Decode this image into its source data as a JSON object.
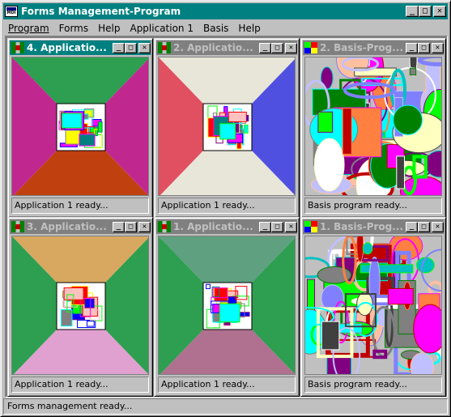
{
  "window": {
    "title": "Forms Management-Program",
    "buttons": {
      "minimize": "_",
      "maximize": "□",
      "close": "✕"
    }
  },
  "menu": [
    "Program",
    "Forms",
    "Help",
    "Application 1",
    "Basis",
    "Help"
  ],
  "children": [
    {
      "title": "4. Applicatio...",
      "status": "Application 1 ready...",
      "kind": "application",
      "active": true,
      "colors": {
        "top": "#2e9e50",
        "bottom": "#c04010",
        "left": "#c02890",
        "right": "#c02890"
      }
    },
    {
      "title": "2. Applicatio...",
      "status": "Application 1 ready...",
      "kind": "application",
      "active": false,
      "colors": {
        "top": "#e8e6d8",
        "bottom": "#e8e6d8",
        "left": "#e05060",
        "right": "#5050e0"
      }
    },
    {
      "title": "2. Basis-Prog...",
      "status": "Basis program ready...",
      "kind": "basis",
      "active": false
    },
    {
      "title": "3. Applicatio...",
      "status": "Application 1 ready...",
      "kind": "application",
      "active": false,
      "colors": {
        "top": "#d8a860",
        "bottom": "#e0a0d0",
        "left": "#2e9e50",
        "right": "#2e9e50"
      }
    },
    {
      "title": "1. Applicatio...",
      "status": "Application 1 ready...",
      "kind": "application",
      "active": false,
      "colors": {
        "top": "#5ea080",
        "bottom": "#b07090",
        "left": "#2e9e50",
        "right": "#2e9e50"
      }
    },
    {
      "title": "1. Basis-Prog...",
      "status": "Basis program ready...",
      "kind": "basis",
      "active": false
    }
  ],
  "statusbar": {
    "text": "Forms management ready..."
  }
}
